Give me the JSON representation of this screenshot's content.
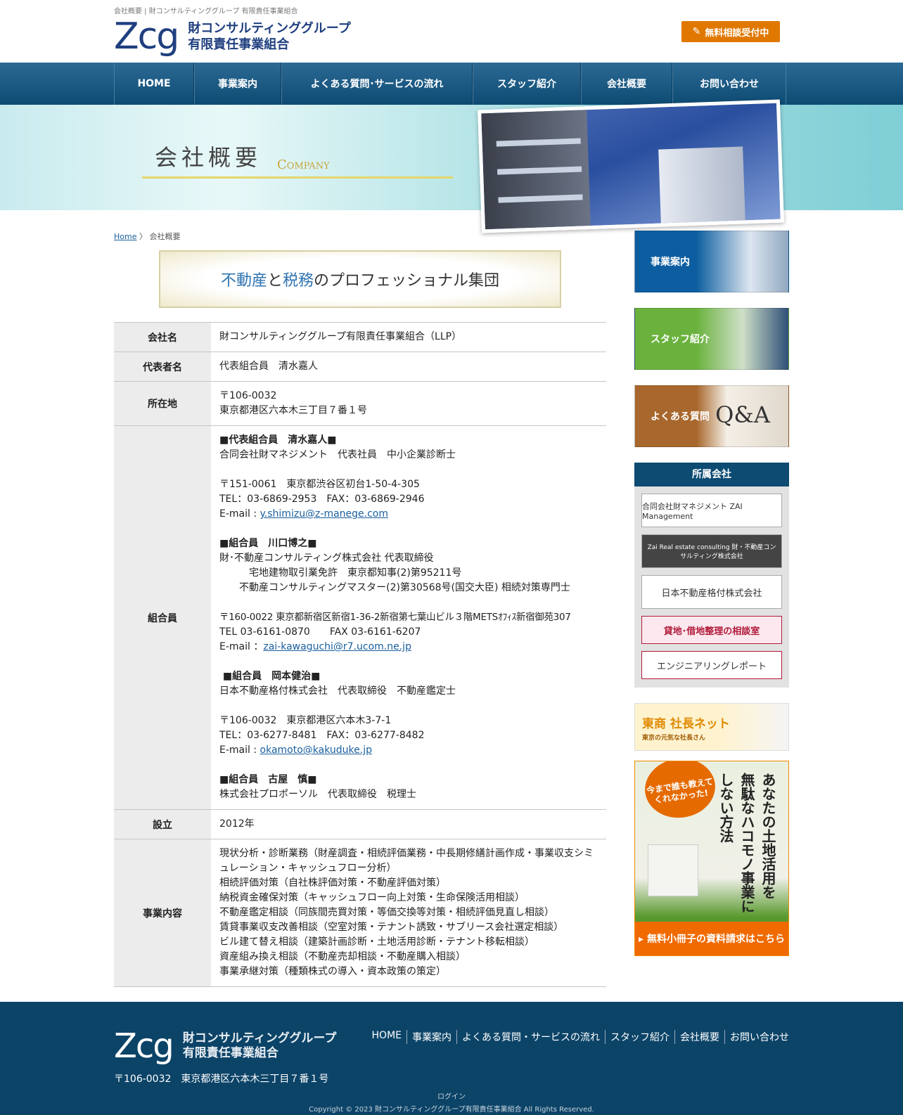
{
  "header": {
    "tagline": "会社概要 | 財コンサルティンググループ 有限責任事業組合",
    "logo_mark": "Zcg",
    "logo_line1": "財コンサルティンググループ",
    "logo_line2": "有限責任事業組合",
    "cta_label": "無料相談受付中"
  },
  "nav": [
    "HOME",
    "事業案内",
    "よくある質問･サービスの流れ",
    "スタッフ紹介",
    "会社概要",
    "お問い合わせ"
  ],
  "banner": {
    "title_jp": "会社概要",
    "title_en": "Company"
  },
  "breadcrumb": {
    "home": "Home",
    "sep": " 〉",
    "current": "会社概要"
  },
  "catch": {
    "part1": "不動産",
    "part2": "と",
    "part3": "税務",
    "part4": "のプロフェッショナル集団"
  },
  "table": {
    "company_label": "会社名",
    "company_value": "財コンサルティンググループ有限責任事業組合（LLP）",
    "rep_label": "代表者名",
    "rep_value": "代表組合員　清水嘉人",
    "addr_label": "所在地",
    "addr_line1": "〒106-0032",
    "addr_line2": "東京都港区六本木三丁目７番１号",
    "members_label": "組合員",
    "m1_title": "■代表組合員　清水嘉人■",
    "m1_l1": "合同会社財マネジメント　代表社員　中小企業診断士",
    "m1_l2": "〒151-0061　東京都渋谷区初台1-50-4-305",
    "m1_l3": "TEL：03-6869-2953　FAX：03-6869-2946",
    "m1_mail_prefix": "E-mail : ",
    "m1_mail": "y.shimizu@z-manege.com",
    "m2_title": "■組合員　川口博之■",
    "m2_l1": "財･不動産コンサルティング株式会社 代表取締役",
    "m2_l2": "　　　宅地建物取引業免許　東京都知事(2)第95211号",
    "m2_l3": "　　不動産コンサルティングマスター(2)第30568号(国交大臣) 相続対策専門士",
    "m2_l4": "〒160-0022 東京都新宿区新宿1-36-2新宿第七葉山ビル３階METSｵﾌｨｽ新宿御苑307",
    "m2_l5": "TEL 03-6161-0870　　FAX 03-6161-6207",
    "m2_mail_prefix": "E-mail ：",
    "m2_mail": "zai-kawaguchi@r7.ucom.ne.jp",
    "m3_title": " ■組合員　岡本健治■",
    "m3_l1": "日本不動産格付株式会社　代表取締役　不動産鑑定士",
    "m3_l2": "〒106-0032　東京都港区六本木3-7-1",
    "m3_l3": "TEL：03-6277-8481　FAX：03-6277-8482",
    "m3_mail_prefix": "E-mail : ",
    "m3_mail": "okamoto@kakuduke.jp",
    "m4_title": "■組合員　古屋　慎■",
    "m4_l1": "株式会社プロポーソル　代表取締役　税理士",
    "est_label": "設立",
    "est_value": "2012年",
    "biz_label": "事業内容",
    "biz_lines": [
      "現状分析・診断業務（財産調査・相続評価業務・中長期修繕計画作成・事業収支シミュレーション・キャッシュフロー分析）",
      "相続評価対策（自社株評価対策・不動産評価対策）",
      "納税資金確保対策（キャッシュフロー向上対策・生命保険活用相談）",
      "不動産鑑定相談（同族間売買対策・等価交換等対策・相続評価見直し相談）",
      "賃貸事業収支改善相談（空室対策・テナント誘致・サブリース会社選定相談）",
      "ビル建て替え相談（建築計画診断・土地活用診断・テナント移転相談）",
      "資産組み換え相談（不動産売却相談・不動産購入相談）",
      "事業承継対策（種類株式の導入・資本政策の策定）"
    ]
  },
  "sidebar": {
    "btn_business": "事業案内",
    "btn_staff": "スタッフ紹介",
    "btn_faq": "よくある質問",
    "btn_faq_deco": "Q&A",
    "affiliates_title": "所属会社",
    "aff1": "合同会社財マネジメント ZAI Management",
    "aff2": "Zai Real estate consulting 財・不動産コンサルティング株式会社",
    "aff3": "日本不動産格付株式会社",
    "aff4": "貸地･借地整理の相談室",
    "aff5": "エンジニアリングレポート",
    "tosho_title": "東商 社長ネット",
    "tosho_sub": "東京の元気な社長さん",
    "book_bubble": "今まで誰も教えてくれなかった!",
    "book_col1": "あなたの土地活用を",
    "book_col2": "無駄なハコモノ事業に",
    "book_col3": "しない方法",
    "book_cta": "▸ 無料小冊子の資料請求はこちら"
  },
  "footer": {
    "logo_mark": "Zcg",
    "logo_line1": "財コンサルティンググループ",
    "logo_line2": "有限責任事業組合",
    "address": "〒106-0032　東京都港区六本木三丁目７番１号",
    "nav": [
      "HOME",
      "事業案内",
      "よくある質問・サービスの流れ",
      "スタッフ紹介",
      "会社概要",
      "お問い合わせ"
    ],
    "login": "ログイン",
    "copyright": "Copyright © 2023 財コンサルティンググループ有限責任事業組合 All Rights Reserved."
  }
}
